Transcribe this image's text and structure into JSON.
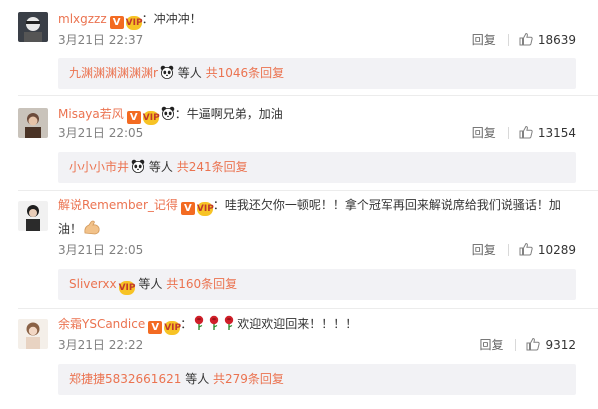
{
  "comments": [
    {
      "username": "mlxgzzz",
      "separator": "：",
      "text": "冲冲冲！",
      "time": "3月21日 22:37",
      "reply_label": "回复",
      "likes": "18639",
      "replies_preview": {
        "name": "九渊渊渊渊渊渊r",
        "mid": "等人",
        "count_link": "共1046条回复"
      }
    },
    {
      "username": "Misaya若风",
      "separator": "：",
      "text": "牛逼啊兄弟，加油",
      "time": "3月21日 22:05",
      "reply_label": "回复",
      "likes": "13154",
      "replies_preview": {
        "name": "小小小市井",
        "mid": "等人",
        "count_link": "共241条回复"
      }
    },
    {
      "username": "解说Remember_记得",
      "separator": "：",
      "text": "哇我还欠你一顿呢！！拿个冠军再回来解说席给我们说骚话！加油！",
      "time": "3月21日 22:05",
      "reply_label": "回复",
      "likes": "10289",
      "replies_preview": {
        "name": "Sliverxx",
        "mid": "等人",
        "count_link": "共160条回复"
      }
    },
    {
      "username": "余霜YSCandice",
      "separator": "：",
      "text": "欢迎欢迎回来！！！！",
      "time": "3月21日 22:22",
      "reply_label": "回复",
      "likes": "9312",
      "replies_preview": {
        "name": "郑捷捷5832661621",
        "mid": "等人",
        "count_link": "共279条回复"
      }
    }
  ],
  "badges": {
    "verified": "V",
    "vip": "VIP"
  },
  "icons": [
    "verified-badge",
    "vip-badge",
    "panda-emoji",
    "flex-arm-emoji",
    "rose-emoji",
    "thumbs-up-icon"
  ],
  "colors": {
    "username": "#eb7350",
    "verified": "#f36b22",
    "vip": "#f7c325",
    "reply_bg": "#f2f2f5",
    "meta": "#808080"
  }
}
